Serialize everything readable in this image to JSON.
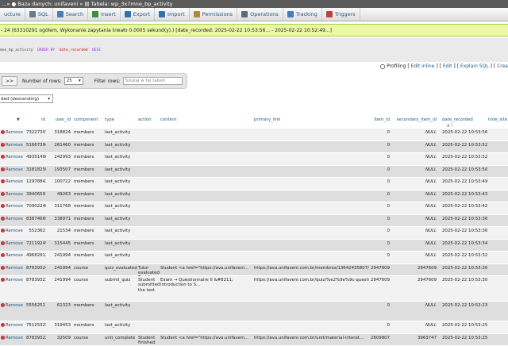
{
  "breadcrumb": {
    "text": "…» ● Baza danych: unifaveni » ▤ Tabela: wp_3x7mne_bp_activity"
  },
  "tabs": [
    {
      "label": "ucture",
      "icon": "structure-icon",
      "color": "#5b8fbf"
    },
    {
      "label": "SQL",
      "icon": "sql-icon",
      "color": "#6a7b8b"
    },
    {
      "label": "Search",
      "icon": "search-icon",
      "color": "#4a7db3"
    },
    {
      "label": "Insert",
      "icon": "insert-icon",
      "color": "#3a8f3a"
    },
    {
      "label": "Export",
      "icon": "export-icon",
      "color": "#3670b0"
    },
    {
      "label": "Import",
      "icon": "import-icon",
      "color": "#3670b0"
    },
    {
      "label": "Permissions",
      "icon": "permissions-icon",
      "color": "#b08a3a"
    },
    {
      "label": "Operations",
      "icon": "operations-icon",
      "color": "#5a6a7a"
    },
    {
      "label": "Tracking",
      "icon": "tracking-icon",
      "color": "#4a7db3"
    },
    {
      "label": "Triggers",
      "icon": "triggers-icon",
      "color": "#c04040"
    }
  ],
  "message": "- 24 (63310291 ogółem, Wykonanie zapytania trwało 0.0005 sekund(y).) [date_recorded: 2025-02-22 10:53:56... - 2025-02-22 10:52:49...]",
  "sql": {
    "table": "mne_bp_activity`",
    "order": "ORDER BY",
    "col": "`date_recorded`",
    "dir": "DESC"
  },
  "profiling": {
    "label": "Profiling",
    "links": [
      "Edit inline",
      "Edit",
      "Explain SQL",
      "Crea"
    ]
  },
  "nav": {
    "next": ">>",
    "rows_label": "Number of rows:",
    "rows_value": "25",
    "filter_label": "Filter rows:",
    "filter_placeholder": "Szukaj w tej tabeli"
  },
  "sort": {
    "value": "ded (descending)"
  },
  "columns": [
    "id",
    "user_id",
    "component",
    "type",
    "action",
    "content",
    "primary_link",
    "item_id",
    "secondary_item_id",
    "date_recorded",
    "hide_site"
  ],
  "sort_arrow": "▲ 1",
  "remove_label": "Remove",
  "rows": [
    {
      "id": "73227307",
      "user_id": "318824",
      "component": "members",
      "type": "last_activity",
      "action": "",
      "content": "",
      "primary_link": "",
      "item_id": "0",
      "secondary_item_id": "NULL",
      "date_recorded": "2025-02-22 10:53:56"
    },
    {
      "id": "51667394",
      "user_id": "261460",
      "component": "members",
      "type": "last_activity",
      "action": "",
      "content": "",
      "primary_link": "",
      "item_id": "0",
      "secondary_item_id": "NULL",
      "date_recorded": "2025-02-22 10:53:52"
    },
    {
      "id": "49351460",
      "user_id": "242993",
      "component": "members",
      "type": "last_activity",
      "action": "",
      "content": "",
      "primary_link": "",
      "item_id": "0",
      "secondary_item_id": "NULL",
      "date_recorded": "2025-02-22 10:53:52"
    },
    {
      "id": "31818250",
      "user_id": "193507",
      "component": "members",
      "type": "last_activity",
      "action": "",
      "content": "",
      "primary_link": "",
      "item_id": "0",
      "secondary_item_id": "NULL",
      "date_recorded": "2025-02-22 10:53:50"
    },
    {
      "id": "12978842",
      "user_id": "100722",
      "component": "members",
      "type": "last_activity",
      "action": "",
      "content": "",
      "primary_link": "",
      "item_id": "0",
      "secondary_item_id": "NULL",
      "date_recorded": "2025-02-22 10:53:49"
    },
    {
      "id": "3940659",
      "user_id": "49263",
      "component": "members",
      "type": "last_activity",
      "action": "",
      "content": "",
      "primary_link": "",
      "item_id": "0",
      "secondary_item_id": "NULL",
      "date_recorded": "2025-02-22 10:53:43"
    },
    {
      "id": "70902246",
      "user_id": "311768",
      "component": "members",
      "type": "last_activity",
      "action": "",
      "content": "",
      "primary_link": "",
      "item_id": "0",
      "secondary_item_id": "NULL",
      "date_recorded": "2025-02-22 10:53:42"
    },
    {
      "id": "83874669",
      "user_id": "338971",
      "component": "members",
      "type": "last_activity",
      "action": "",
      "content": "",
      "primary_link": "",
      "item_id": "0",
      "secondary_item_id": "NULL",
      "date_recorded": "2025-02-22 10:53:36"
    },
    {
      "id": "552362",
      "user_id": "21534",
      "component": "members",
      "type": "last_activity",
      "action": "",
      "content": "",
      "primary_link": "",
      "item_id": "0",
      "secondary_item_id": "NULL",
      "date_recorded": "2025-02-22 10:53:36"
    },
    {
      "id": "72119249",
      "user_id": "315445",
      "component": "members",
      "type": "last_activity",
      "action": "",
      "content": "",
      "primary_link": "",
      "item_id": "0",
      "secondary_item_id": "NULL",
      "date_recorded": "2025-02-22 10:53:34"
    },
    {
      "id": "49682913",
      "user_id": "241994",
      "component": "members",
      "type": "last_activity",
      "action": "",
      "content": "",
      "primary_link": "",
      "item_id": "0",
      "secondary_item_id": "NULL",
      "date_recorded": "2025-02-22 10:53:32"
    },
    {
      "id": "87839324",
      "user_id": "241994",
      "component": "course",
      "type": "quiz_evaluated",
      "action": "Tutor evaluated Test for the student",
      "content": "Student <a href=\"https://ava.unifaveni...",
      "primary_link": "https://ava.unifaveni.com.br/membros/13642435807/c...",
      "item_id": "2947609",
      "secondary_item_id": "2947609",
      "date_recorded": "2025-02-22 10:53:30"
    },
    {
      "id": "87839323",
      "user_id": "241994",
      "component": "course",
      "type": "submit_quiz",
      "action": "Student submitted the test",
      "content": "Exam → Questionnaire II &#8211; Introduction to S...",
      "primary_link": "https://ava.unifaveni.com.br/quiz/%e2%9e%9c-questi...",
      "item_id": "2947609",
      "secondary_item_id": "2947609",
      "date_recorded": "2025-02-22 10:53:30"
    },
    {
      "id": "5556251",
      "user_id": "61323",
      "component": "members",
      "type": "last_activity",
      "action": "",
      "content": "",
      "primary_link": "",
      "item_id": "0",
      "secondary_item_id": "NULL",
      "date_recorded": "2025-02-22 10:53:23"
    },
    {
      "id": "75125325",
      "user_id": "319453",
      "component": "members",
      "type": "last_activity",
      "action": "",
      "content": "",
      "primary_link": "",
      "item_id": "0",
      "secondary_item_id": "NULL",
      "date_recorded": "2025-02-22 10:53:25"
    },
    {
      "id": "87839322",
      "user_id": "32509",
      "component": "course",
      "type": "unit_complete",
      "action": "Student finished",
      "content": "Student <a href=\"https://ava.unifaveni...",
      "primary_link": "https://ava.unifaveni.com.br/unit/material-interat...",
      "item_id": "2809807",
      "secondary_item_id": "3963747",
      "date_recorded": "2025-02-22 10:53:25"
    }
  ]
}
